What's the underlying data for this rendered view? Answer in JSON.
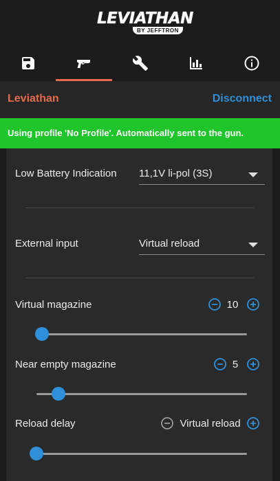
{
  "logo": {
    "main": "LEVIATHAN",
    "sub": "BY JEFFTRON"
  },
  "tabs": [
    {
      "name": "save-icon",
      "active": false
    },
    {
      "name": "gun-icon",
      "active": true
    },
    {
      "name": "wrench-icon",
      "active": false
    },
    {
      "name": "bar-chart-icon",
      "active": false
    },
    {
      "name": "info-icon",
      "active": false
    }
  ],
  "header": {
    "device": "Leviathan",
    "disconnect": "Disconnect"
  },
  "banner": {
    "text": "Using profile 'No Profile'. Automatically sent to the gun."
  },
  "settings": {
    "low_battery": {
      "label": "Low Battery Indication",
      "value": "11,1V li-pol (3S)"
    },
    "external_input": {
      "label": "External input",
      "value": "Virtual reload"
    },
    "virtual_magazine": {
      "label": "Virtual magazine",
      "value": "10",
      "slider_fraction": 0.025
    },
    "near_empty": {
      "label": "Near empty magazine",
      "value": "5",
      "slider_fraction": 0.105
    },
    "reload_delay": {
      "label": "Reload delay",
      "value": "Virtual reload",
      "slider_fraction": 0.0
    }
  },
  "colors": {
    "accent": "#e56a4e",
    "link": "#2f8fd8",
    "banner": "#1fc52a"
  }
}
